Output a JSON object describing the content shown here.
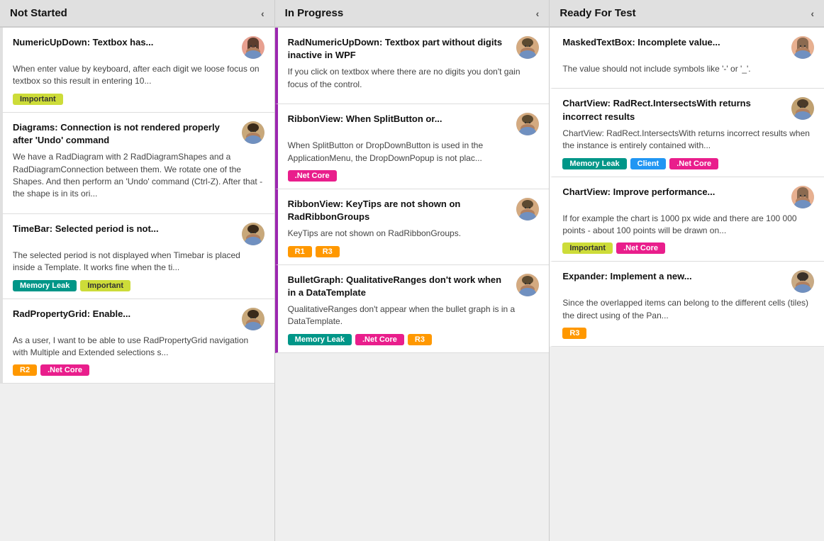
{
  "columns": [
    {
      "id": "not-started",
      "title": "Not Started",
      "chevron": "‹",
      "cards": [
        {
          "id": "ns-1",
          "title": "NumericUpDown: Textbox has...",
          "body": "When enter value by keyboard, after each digit we loose focus on textbox so this result in entering 10...",
          "avatar_type": "female1",
          "tags": [
            {
              "label": "Important",
              "type": "important"
            }
          ]
        },
        {
          "id": "ns-2",
          "title": "Diagrams: Connection is not rendered properly after 'Undo' command",
          "body": "We have a RadDiagram with 2 RadDiagramShapes and a RadDiagramConnection between them. We rotate one of the Shapes. And then perform an 'Undo' command (Ctrl-Z). After that - the shape is in its ori...",
          "avatar_type": "male1",
          "tags": []
        },
        {
          "id": "ns-3",
          "title": "TimeBar: Selected period is not...",
          "body": "The selected period is not displayed when Timebar is placed inside a Template. It works fine when the ti...",
          "avatar_type": "male1",
          "tags": [
            {
              "label": "Memory Leak",
              "type": "memory-leak"
            },
            {
              "label": "Important",
              "type": "important"
            }
          ]
        },
        {
          "id": "ns-4",
          "title": "RadPropertyGrid: Enable...",
          "body": "As a user, I want to be able to use RadPropertyGrid navigation with Multiple and Extended selections s...",
          "avatar_type": "male1",
          "tags": [
            {
              "label": "R2",
              "type": "r2"
            },
            {
              "label": ".Net Core",
              "type": "dotnet-core"
            }
          ]
        }
      ]
    },
    {
      "id": "in-progress",
      "title": "In Progress",
      "chevron": "‹",
      "cards": [
        {
          "id": "ip-1",
          "title": "RadNumericUpDown: Textbox part without digits inactive in WPF",
          "body": "If you click on textbox where there are no digits you don't gain focus of the control.",
          "avatar_type": "male2",
          "tags": []
        },
        {
          "id": "ip-2",
          "title": "RibbonView: When SplitButton or...",
          "body": "When SplitButton or DropDownButton is used in the ApplicationMenu, the DropDownPopup is not plac...",
          "avatar_type": "male2",
          "tags": [
            {
              "label": ".Net Core",
              "type": "dotnet-core"
            }
          ]
        },
        {
          "id": "ip-3",
          "title": "RibbonView: KeyTips are not shown on RadRibbonGroups",
          "body": "KeyTips are not shown on RadRibbonGroups.",
          "avatar_type": "male2",
          "tags": [
            {
              "label": "R1",
              "type": "r1"
            },
            {
              "label": "R3",
              "type": "r3"
            }
          ]
        },
        {
          "id": "ip-4",
          "title": "BulletGraph: QualitativeRanges don't work when in a DataTemplate",
          "body": "QualitativeRanges don't appear when the bullet graph is in a DataTemplate.",
          "avatar_type": "male2",
          "tags": [
            {
              "label": "Memory Leak",
              "type": "memory-leak"
            },
            {
              "label": ".Net Core",
              "type": "dotnet-core"
            },
            {
              "label": "R3",
              "type": "r3"
            }
          ]
        }
      ]
    },
    {
      "id": "ready-for-test",
      "title": "Ready For Test",
      "chevron": "‹",
      "cards": [
        {
          "id": "rft-1",
          "title": "MaskedTextBox: Incomplete value...",
          "body": "The value should not include symbols like '-' or '_'.",
          "avatar_type": "female2",
          "tags": []
        },
        {
          "id": "rft-2",
          "title": "ChartView: RadRect.IntersectsWith returns incorrect results",
          "body": "ChartView: RadRect.IntersectsWith returns incorrect results when the instance is entirely contained with...",
          "avatar_type": "male3",
          "tags": [
            {
              "label": "Memory Leak",
              "type": "memory-leak"
            },
            {
              "label": "Client",
              "type": "client"
            },
            {
              "label": ".Net Core",
              "type": "dotnet-core"
            }
          ]
        },
        {
          "id": "rft-3",
          "title": "ChartView: Improve performance...",
          "body": "If for example the chart is 1000 px wide and there are 100 000 points - about 100 points will be drawn on...",
          "avatar_type": "female2",
          "tags": [
            {
              "label": "Important",
              "type": "important"
            },
            {
              "label": ".Net Core",
              "type": "dotnet-core"
            }
          ]
        },
        {
          "id": "rft-4",
          "title": "Expander: Implement a new...",
          "body": "Since the overlapped items can belong to the different cells (tiles) the direct using of the Pan...",
          "avatar_type": "male4",
          "tags": [
            {
              "label": "R3",
              "type": "r3"
            }
          ]
        }
      ]
    }
  ],
  "tag_labels": {
    "important": "Important",
    "memory-leak": "Memory Leak",
    "dotnet-core": ".Net Core",
    "client": "Client",
    "r1": "R1",
    "r2": "R2",
    "r3": "R3"
  }
}
